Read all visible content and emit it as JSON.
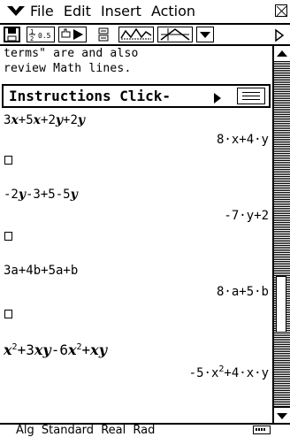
{
  "menubar": {
    "items": [
      "File",
      "Edit",
      "Insert",
      "Action"
    ]
  },
  "content": {
    "intro_line1": "terms\" are and also",
    "intro_line2": "review Math lines.",
    "instructions_label": "Instructions Click-",
    "lines": [
      {
        "input_parts": [
          [
            "b",
            "3"
          ],
          [
            "bi",
            "x"
          ],
          [
            "t",
            "+5"
          ],
          [
            "bi",
            "x"
          ],
          [
            "t",
            "+2"
          ],
          [
            "bi",
            "y"
          ],
          [
            "t",
            "+2"
          ],
          [
            "bi",
            "y"
          ]
        ],
        "result": "8·x+4·y"
      },
      {
        "input_text": "-2y-3+5-5y",
        "result": "-7·y+2"
      },
      {
        "input_text": "3a+4b+5a+b",
        "result": "8·a+5·b"
      },
      {
        "input_text": "x2+3xy-6x2+xy",
        "result": "-5·x2+4·x·y"
      }
    ]
  },
  "statusbar": {
    "items": [
      "Alg",
      "Standard",
      "Real",
      "Rad"
    ]
  },
  "icons": {
    "menu": "chevron-down-icon",
    "close": "close-icon",
    "save": "floppy-disk-icon",
    "fraction": "fraction-decimal-icon",
    "pointer": "pointer-run-icon",
    "split": "split-view-icon",
    "graph": "graph-icon",
    "geometry": "geometry-icon",
    "dropdown": "chevron-down-icon",
    "scroll": "chevron-right-icon",
    "battery": "battery-icon"
  },
  "colors": {
    "foreground": "#000000",
    "background": "#ffffff"
  }
}
